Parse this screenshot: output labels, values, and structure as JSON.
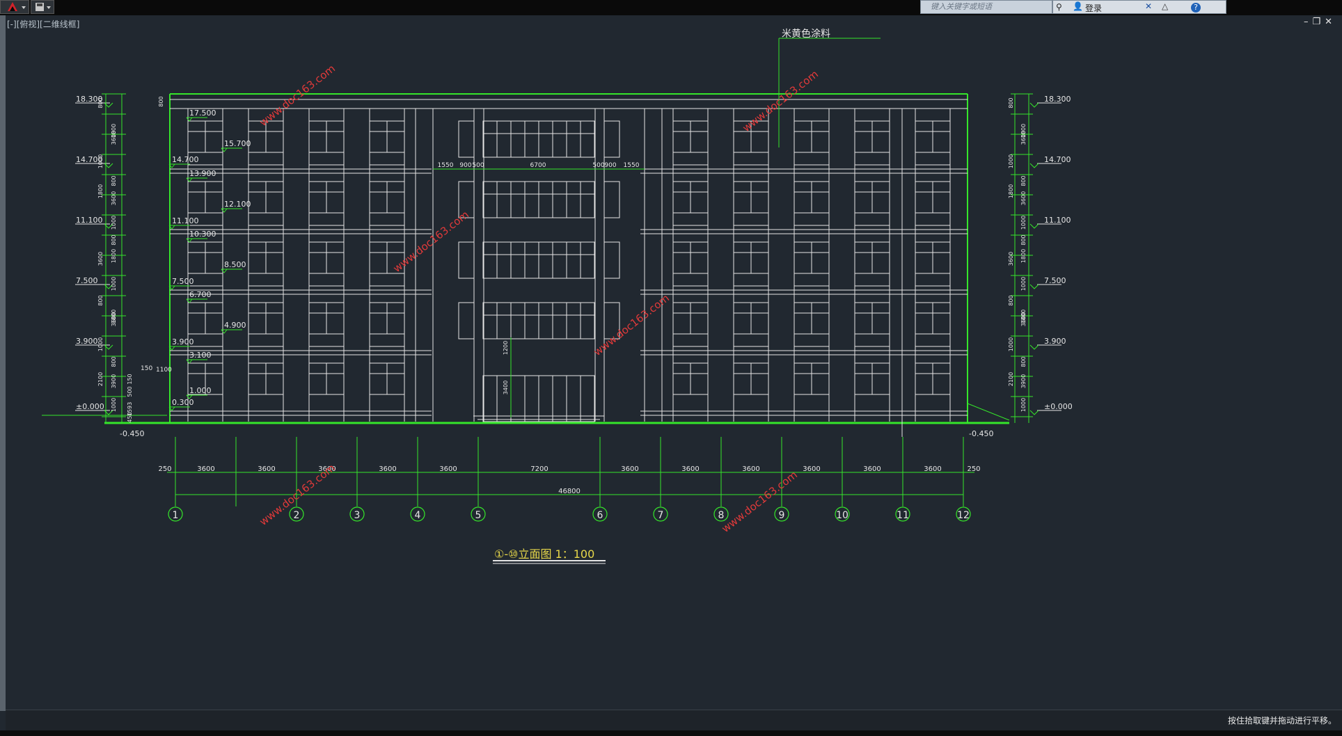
{
  "app": {
    "menu_icon": "autocad-a-icon",
    "search_placeholder": "键入关键字或短语",
    "login_label": "登录",
    "view_label": "[-][俯视][二维线框]"
  },
  "drawing": {
    "note": "米黄色涂料",
    "title": "①-⑩立面图 1：100",
    "watermark": "www.doc163.com",
    "levels_left": [
      "18.300",
      "14.700",
      "11.100",
      "7.500",
      "3.900",
      "±0.000"
    ],
    "levels_right": [
      "18.300",
      "14.700",
      "11.100",
      "7.500",
      "3.900",
      "±0.000"
    ],
    "ground_left": "-0.450",
    "ground_right": "-0.450",
    "inner_levels": [
      "17.500",
      "15.700",
      "14.700",
      "13.900",
      "12.100",
      "11.100",
      "10.300",
      "8.500",
      "7.500",
      "6.700",
      "4.900",
      "3.900",
      "3.100",
      "1.000",
      "0.300"
    ],
    "dim_labels_left": [
      "800",
      "3600",
      "1800",
      "1000",
      "800",
      "3600",
      "1800",
      "1000",
      "800",
      "3600",
      "1800",
      "1000",
      "800",
      "3600",
      "1800",
      "1000",
      "800",
      "3900",
      "2100",
      "1000",
      "450",
      "150",
      "1593",
      "500"
    ],
    "dim_labels_top": [
      "1550",
      "900",
      "500",
      "6700",
      "500",
      "900",
      "1550"
    ],
    "small_dims": [
      "150",
      "1100",
      "1200",
      "3400",
      "800"
    ],
    "bay_dims": [
      "250",
      "3600",
      "3600",
      "3600",
      "3600",
      "3600",
      "7200",
      "3600",
      "3600",
      "3600",
      "3600",
      "3600",
      "3600",
      "250"
    ],
    "total_dim": "46800",
    "axes": [
      "1",
      "2",
      "3",
      "4",
      "5",
      "6",
      "7",
      "8",
      "9",
      "10",
      "11",
      "12"
    ]
  },
  "status": {
    "message": "按住拾取键并拖动进行平移。"
  },
  "colors": {
    "background": "#212830",
    "line_green": "#35e62a",
    "line_white": "#e6e6e6",
    "title_yellow": "#e8d84a"
  }
}
